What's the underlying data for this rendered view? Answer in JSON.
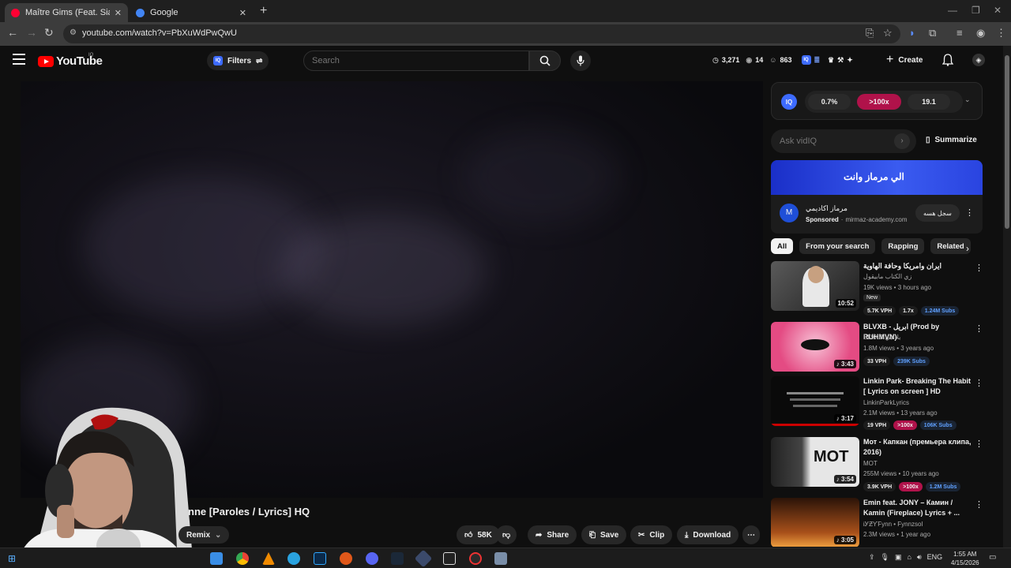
{
  "browser": {
    "tabs": [
      {
        "title": "Maître Gims (Feat. Sia) - Je Te P",
        "favicon_color": "#ff0033",
        "active": true
      },
      {
        "title": "Google",
        "favicon_color": "#4285f4",
        "active": false
      }
    ],
    "new_tab_icon": "plus-icon",
    "url": "youtube.com/watch?v=PbXuWdPwQwU"
  },
  "header": {
    "logo_text": "YouTube",
    "logo_suffix": "IQ",
    "filters_label": "Filters",
    "search_placeholder": "Search",
    "stats": {
      "clock": "3,271",
      "views": "14",
      "subs": "863"
    },
    "create_label": "Create"
  },
  "video": {
    "title_visible": "nne [Paroles / Lyrics] HQ",
    "remix_label": "Remix",
    "likes": "58K",
    "share_label": "Share",
    "save_label": "Save",
    "clip_label": "Clip",
    "download_label": "Download"
  },
  "vidiq": {
    "badge": "IQ",
    "pills": [
      "0.7%",
      ">100x",
      "19.1"
    ],
    "pill_colors": [
      "#2a2a2a",
      "#b0124a",
      "#2a2a2a"
    ],
    "ask_placeholder": "Ask vidIQ",
    "summarize_label": "Summarize"
  },
  "ad": {
    "banner_text": "الي مرماز وانت",
    "advertiser": "مرماز اكاديمي",
    "sponsored": "Sponsored",
    "domain": "mirmaz-academy.com",
    "cta": "سجل هسه"
  },
  "chips": [
    "All",
    "From your search",
    "Rapping",
    "Related"
  ],
  "recommendations": [
    {
      "title": "ايران وامريكا وحافة الهاوية",
      "channel": "زي الكتاب مابيقول",
      "meta": "19K views • 3 hours ago",
      "extra": "New",
      "duration": "10:52",
      "badges": [
        {
          "t": "5.7K VPH",
          "k": ""
        },
        {
          "t": "1.7x",
          "k": ""
        },
        {
          "t": "1.24M Subs",
          "k": "subs"
        }
      ],
      "thumb": "#3a3a3a"
    },
    {
      "title": "BLVXB - ابريل (Prod by RUHMVN)",
      "channel": "BLVXB بلاكبي",
      "meta": "1.8M views • 3 years ago",
      "extra": "",
      "duration": "♪ 3:43",
      "badges": [
        {
          "t": "33 VPH",
          "k": ""
        },
        {
          "t": "239K Subs",
          "k": "subs"
        }
      ],
      "thumb": "#e85a8a"
    },
    {
      "title": "Linkin Park- Breaking The Habit [ Lyrics on screen ] HD",
      "channel": "LinkinParkLyrics",
      "meta": "2.1M views • 13 years ago",
      "extra": "",
      "duration": "♪ 3:17",
      "badges": [
        {
          "t": "19 VPH",
          "k": ""
        },
        {
          "t": ">100x",
          "k": "red"
        },
        {
          "t": "106K Subs",
          "k": "subs"
        }
      ],
      "thumb": "#111111"
    },
    {
      "title": "Мот - Капкан (премьера клипа, 2016)",
      "channel": "MOT",
      "meta": "255M views • 10 years ago",
      "extra": "",
      "duration": "♪ 3:54",
      "badges": [
        {
          "t": "3.9K VPH",
          "k": ""
        },
        {
          "t": ">100x",
          "k": "red"
        },
        {
          "t": "1.2M Subs",
          "k": "subs"
        }
      ],
      "thumb": "#dcdcdc"
    },
    {
      "title": "Emin feat. JONY – Камин / Kamin (Fireplace) Lyrics + ...",
      "channel": "ᎥᎩƵƳFynn • Fynnzsol",
      "meta": "2.3M views • 1 year ago",
      "extra": "",
      "duration": "♪ 3:05",
      "badges": [],
      "thumb": "#5a2a10"
    }
  ],
  "taskbar": {
    "time": "1:55 AM",
    "date": "4/15/2026",
    "lang": "ENG"
  }
}
